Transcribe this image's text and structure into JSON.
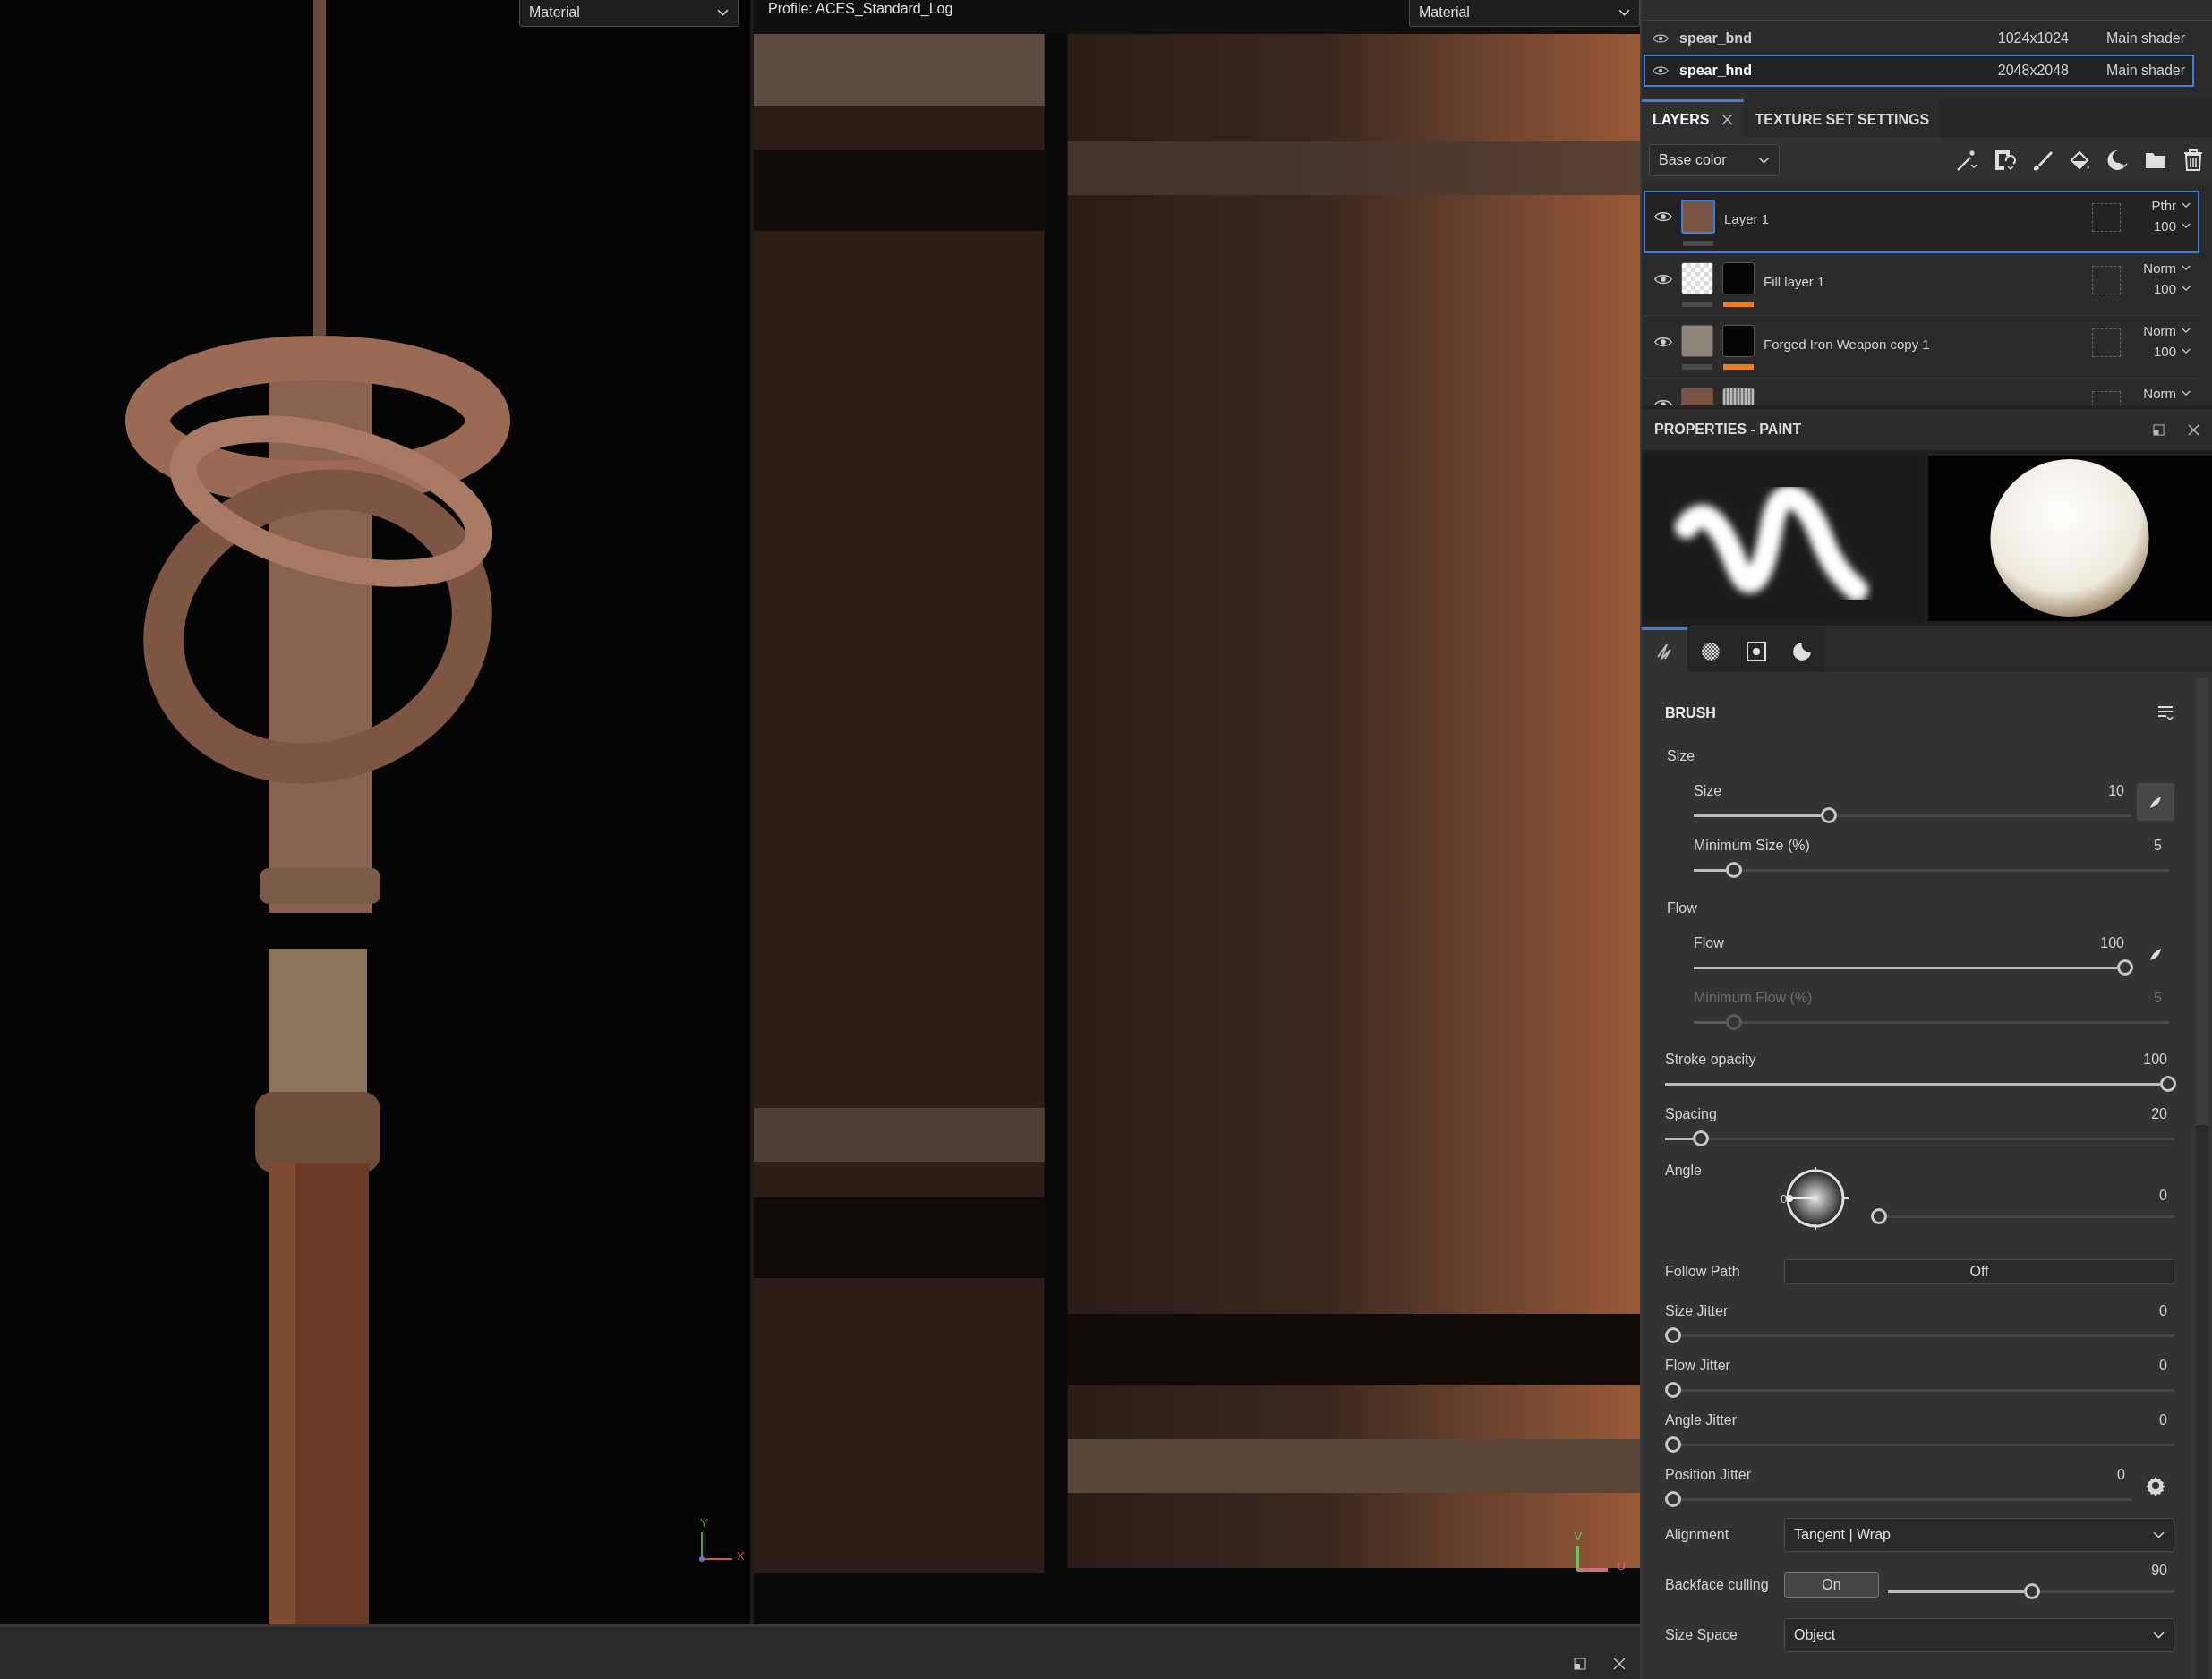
{
  "viewport_3d": {
    "dropdown": "Material",
    "axes": [
      "Y",
      "X"
    ]
  },
  "viewport_2d": {
    "profile": "Profile: ACES_Standard_Log",
    "dropdown": "Material",
    "axes": [
      "V",
      "U"
    ]
  },
  "texture_sets": [
    {
      "name": "spear_bnd",
      "resolution": "1024x1024",
      "shader": "Main shader",
      "selected": false
    },
    {
      "name": "spear_hnd",
      "resolution": "2048x2048",
      "shader": "Main shader",
      "selected": true
    }
  ],
  "tabs": [
    {
      "label": "LAYERS",
      "closable": true,
      "selected": true
    },
    {
      "label": "TEXTURE SET SETTINGS",
      "closable": false,
      "selected": false
    }
  ],
  "channel_dropdown": "Base color",
  "layers": [
    {
      "name": "Layer 1",
      "kind": "paint",
      "blend": "Pthr",
      "opacity": "100",
      "selected": true
    },
    {
      "name": "Fill layer 1",
      "kind": "fill",
      "blend": "Norm",
      "opacity": "100",
      "selected": false
    },
    {
      "name": "Forged Iron Weapon copy 1",
      "kind": "material",
      "blend": "Norm",
      "opacity": "100",
      "selected": false
    },
    {
      "kind": "paint_masked",
      "blend": "Norm",
      "selected": false
    }
  ],
  "properties": {
    "title": "PROPERTIES - PAINT",
    "tool_tabs": [
      {
        "kind": "brush",
        "selected": true
      },
      {
        "kind": "material",
        "selected": false
      },
      {
        "kind": "mask",
        "selected": false
      },
      {
        "kind": "shading",
        "selected": false
      }
    ]
  },
  "brush": {
    "title": "BRUSH",
    "rows": [
      {
        "kind": "group",
        "label": "Size",
        "children": [
          {
            "kind": "slider",
            "label": "Size",
            "value": "10",
            "level": 0.3,
            "disabled": false,
            "pen_pressure": true
          },
          {
            "kind": "slider",
            "label": "Minimum Size (%)",
            "value": "5",
            "level": 0.07,
            "disabled": false
          }
        ]
      },
      {
        "kind": "group",
        "label": "Flow",
        "children": [
          {
            "kind": "slider",
            "label": "Flow",
            "value": "100",
            "level": 1,
            "disabled": false,
            "pen_pressure": false
          },
          {
            "kind": "slider",
            "label": "Minimum Flow (%)",
            "value": "5",
            "level": 0.07,
            "disabled": true
          }
        ]
      },
      {
        "kind": "slider",
        "label": "Stroke opacity",
        "value": "100",
        "level": 1,
        "disabled": false
      },
      {
        "kind": "slider",
        "label": "Spacing",
        "value": "20",
        "level": 0.056,
        "disabled": false
      },
      {
        "kind": "angle",
        "label": "Angle",
        "dial_label": "0",
        "value": "0",
        "level": 0
      },
      {
        "kind": "toggle",
        "label": "Follow Path",
        "value": "Off",
        "on": false
      },
      {
        "kind": "slider",
        "label": "Size Jitter",
        "value": "0",
        "level": 0,
        "disabled": false
      },
      {
        "kind": "slider",
        "label": "Flow Jitter",
        "value": "0",
        "level": 0,
        "disabled": false
      },
      {
        "kind": "slider",
        "label": "Angle Jitter",
        "value": "0",
        "level": 0,
        "disabled": false
      },
      {
        "kind": "slider",
        "label": "Position Jitter",
        "value": "0",
        "level": 0,
        "disabled": false,
        "has_settings": true
      },
      {
        "kind": "dropdown",
        "label": "Alignment",
        "value": "Tangent | Wrap"
      },
      {
        "kind": "toggle_slider",
        "label": "Backface culling",
        "value": "On",
        "on": true,
        "reading": "90",
        "level": 0.5
      },
      {
        "kind": "dropdown",
        "label": "Size Space",
        "value": "Object"
      }
    ]
  }
}
